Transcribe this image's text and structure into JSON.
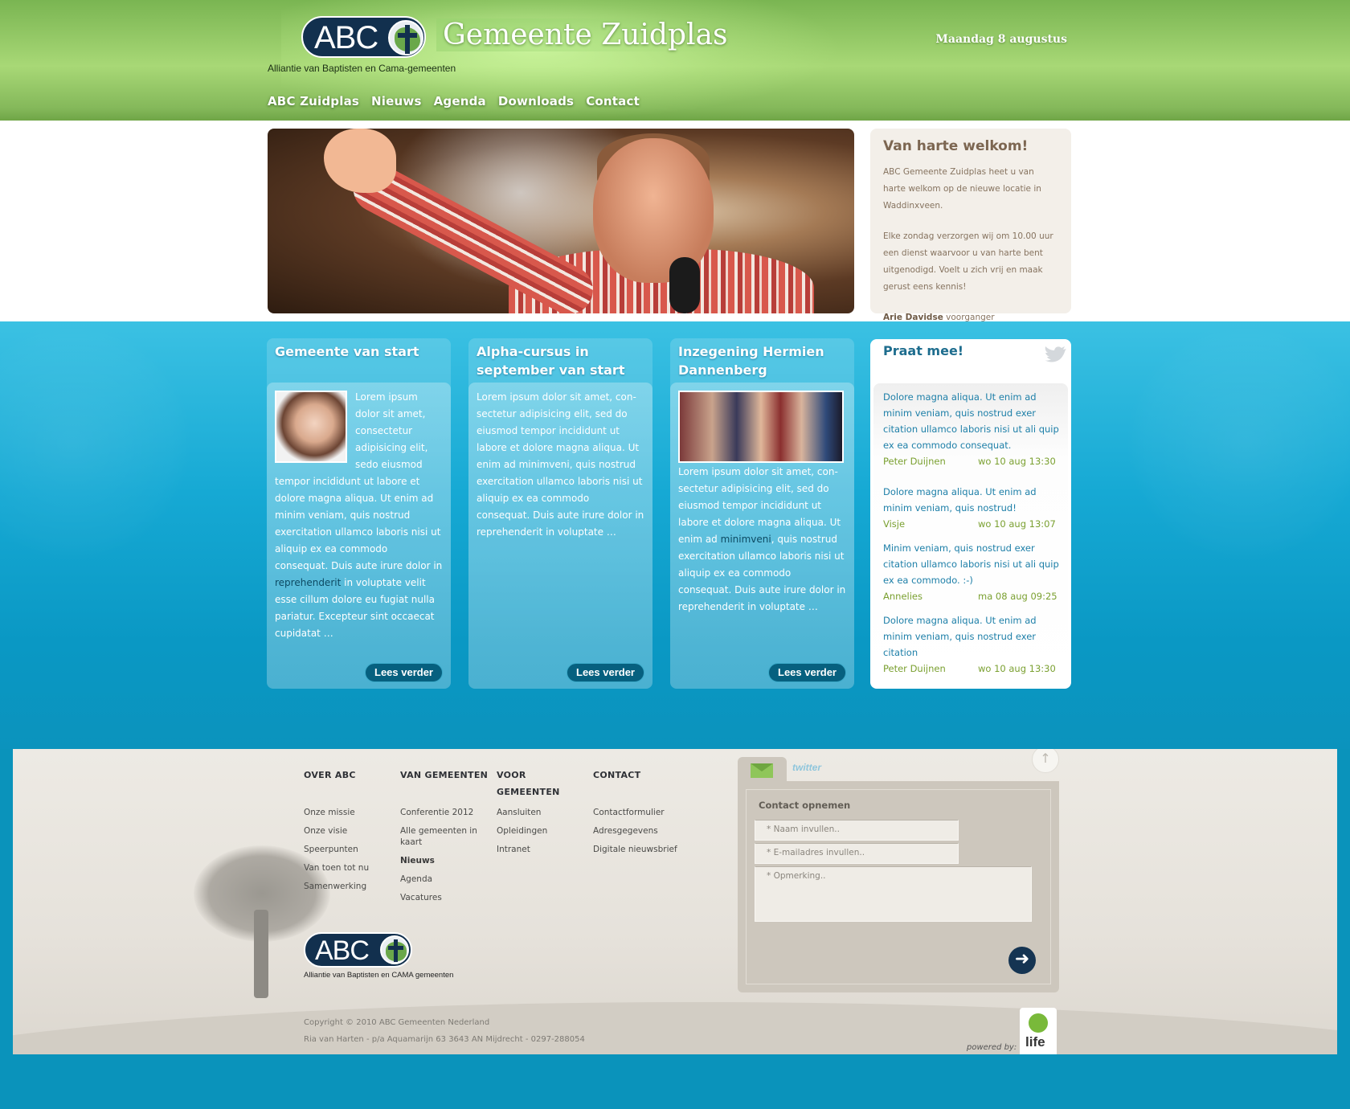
{
  "header": {
    "logo_text": "ABC",
    "site_title": "Gemeente Zuidplas",
    "tagline": "Alliantie van Baptisten en Cama-gemeenten",
    "date": "Maandag 8 augustus",
    "nav": [
      "ABC Zuidplas",
      "Nieuws",
      "Agenda",
      "Downloads",
      "Contact"
    ]
  },
  "welcome": {
    "title": "Van harte welkom!",
    "p1": "ABC Gemeente Zuidplas heet u van harte welkom op de nieuwe locatie in Waddinxveen.",
    "p2": "Elke zondag verzorgen wij om 10.00 uur een dienst waarvoor u van harte bent uitgenodigd. Voelt u zich vrij en maak gerust eens kennis!",
    "sig_name": "Arie Davidse",
    "sig_role": " voorganger"
  },
  "cards": [
    {
      "title": "Gemeente van start",
      "text_a": "Lorem ipsum dolor sit amet, consectetur adipisicing elit, sedo eiusmod tempor incididunt ut labore et dolore magna aliqua. Ut enim ad minim veniam, quis nostrud exercitation ullamco laboris nisi ut aliquip ex ea commodo consequat. Duis aute irure dolor in ",
      "link": "reprehenderit",
      "text_b": " in voluptate velit esse cillum dolore eu fugiat nulla pariatur. Excepteur sint occaecat cupidatat …",
      "button": "Lees verder"
    },
    {
      "title": "Alpha-cursus in september van start",
      "text": "Lorem ipsum dolor sit amet, con-sectetur adipisicing elit, sed do eiusmod tempor incididunt ut labore et dolore magna aliqua. Ut enim ad minimveni, quis nostrud exercitation ullamco laboris nisi ut aliquip ex ea commodo consequat. Duis aute irure dolor in reprehenderit in voluptate …",
      "button": "Lees verder"
    },
    {
      "title": "Inzegening Hermien Dannenberg",
      "text_a": "Lorem ipsum dolor sit amet, con-sectetur adipisicing elit, sed do eiusmod tempor incididunt ut labore et dolore magna aliqua. Ut enim ad ",
      "link": "minimveni",
      "text_b": ", quis nostrud exercitation ullamco laboris nisi ut aliquip ex ea commodo consequat. Duis aute irure dolor in reprehenderit in voluptate …",
      "button": "Lees verder"
    }
  ],
  "praat": {
    "title": "Praat mee!",
    "tweets": [
      {
        "msg": "Dolore magna aliqua. Ut enim ad minim veniam, quis nostrud exer citation ullamco laboris nisi ut ali quip ex ea commodo consequat.",
        "author": "Peter Duijnen",
        "time": "wo 10 aug 13:30"
      },
      {
        "msg": "Dolore magna aliqua. Ut enim ad minim veniam, quis nostrud!",
        "author": "Visje",
        "time": "wo 10 aug 13:07"
      },
      {
        "msg": "Minim veniam, quis nostrud exer citation ullamco laboris nisi ut ali quip ex ea commodo. :-)",
        "author": "Annelies",
        "time": "ma 08 aug 09:25"
      },
      {
        "msg": "Dolore magna aliqua. Ut enim ad minim veniam, quis nostrud exer citation",
        "author": "Peter Duijnen",
        "time": "wo 10 aug 13:30"
      }
    ]
  },
  "footer": {
    "columns": [
      {
        "title": "OVER ABC",
        "items": [
          "Onze missie",
          "Onze visie",
          "Speerpunten",
          "Van toen tot nu",
          "Samenwerking"
        ]
      },
      {
        "title": "VAN GEMEENTEN",
        "items": [
          "Conferentie 2012",
          "Alle gemeenten in kaart",
          "Nieuws",
          "Agenda",
          "Vacatures"
        ]
      },
      {
        "title": "VOOR GEMEENTEN",
        "items": [
          "Aansluiten",
          "Opleidingen",
          "Intranet"
        ]
      },
      {
        "title": "CONTACT",
        "items": [
          "Contactformulier",
          "Adresgegevens",
          "Digitale nieuwsbrief"
        ]
      }
    ],
    "logo_text": "ABC",
    "logo_tagline": "Alliantie van Baptisten en CAMA gemeenten",
    "copyright": "Copyright © 2010 ABC Gemeenten Nederland",
    "address": "Ria van Harten - p/a Aquamarijn 63 3643 AN Mijdrecht - 0297-288054",
    "powered_by": "powered by:",
    "life_logo": "life"
  },
  "contact": {
    "tab_twitter": "twitter",
    "title": "Contact opnemen",
    "name_placeholder": "* Naam invullen..",
    "email_placeholder": "* E-mailadres invullen..",
    "remark_placeholder": "* Opmerking.."
  },
  "icons": {
    "logo": "globe-cross-icon",
    "bird": "twitter-bird-icon",
    "mail": "envelope-icon",
    "send": "arrow-right-icon",
    "up": "arrow-up-icon"
  },
  "colors": {
    "header_green": "#8fc462",
    "content_blue": "#0a98c4",
    "button_dark": "#06607f",
    "tweet_blue": "#1d7fa8",
    "tweet_meta_green": "#7aa030",
    "footer_bg": "#e6e2db"
  }
}
